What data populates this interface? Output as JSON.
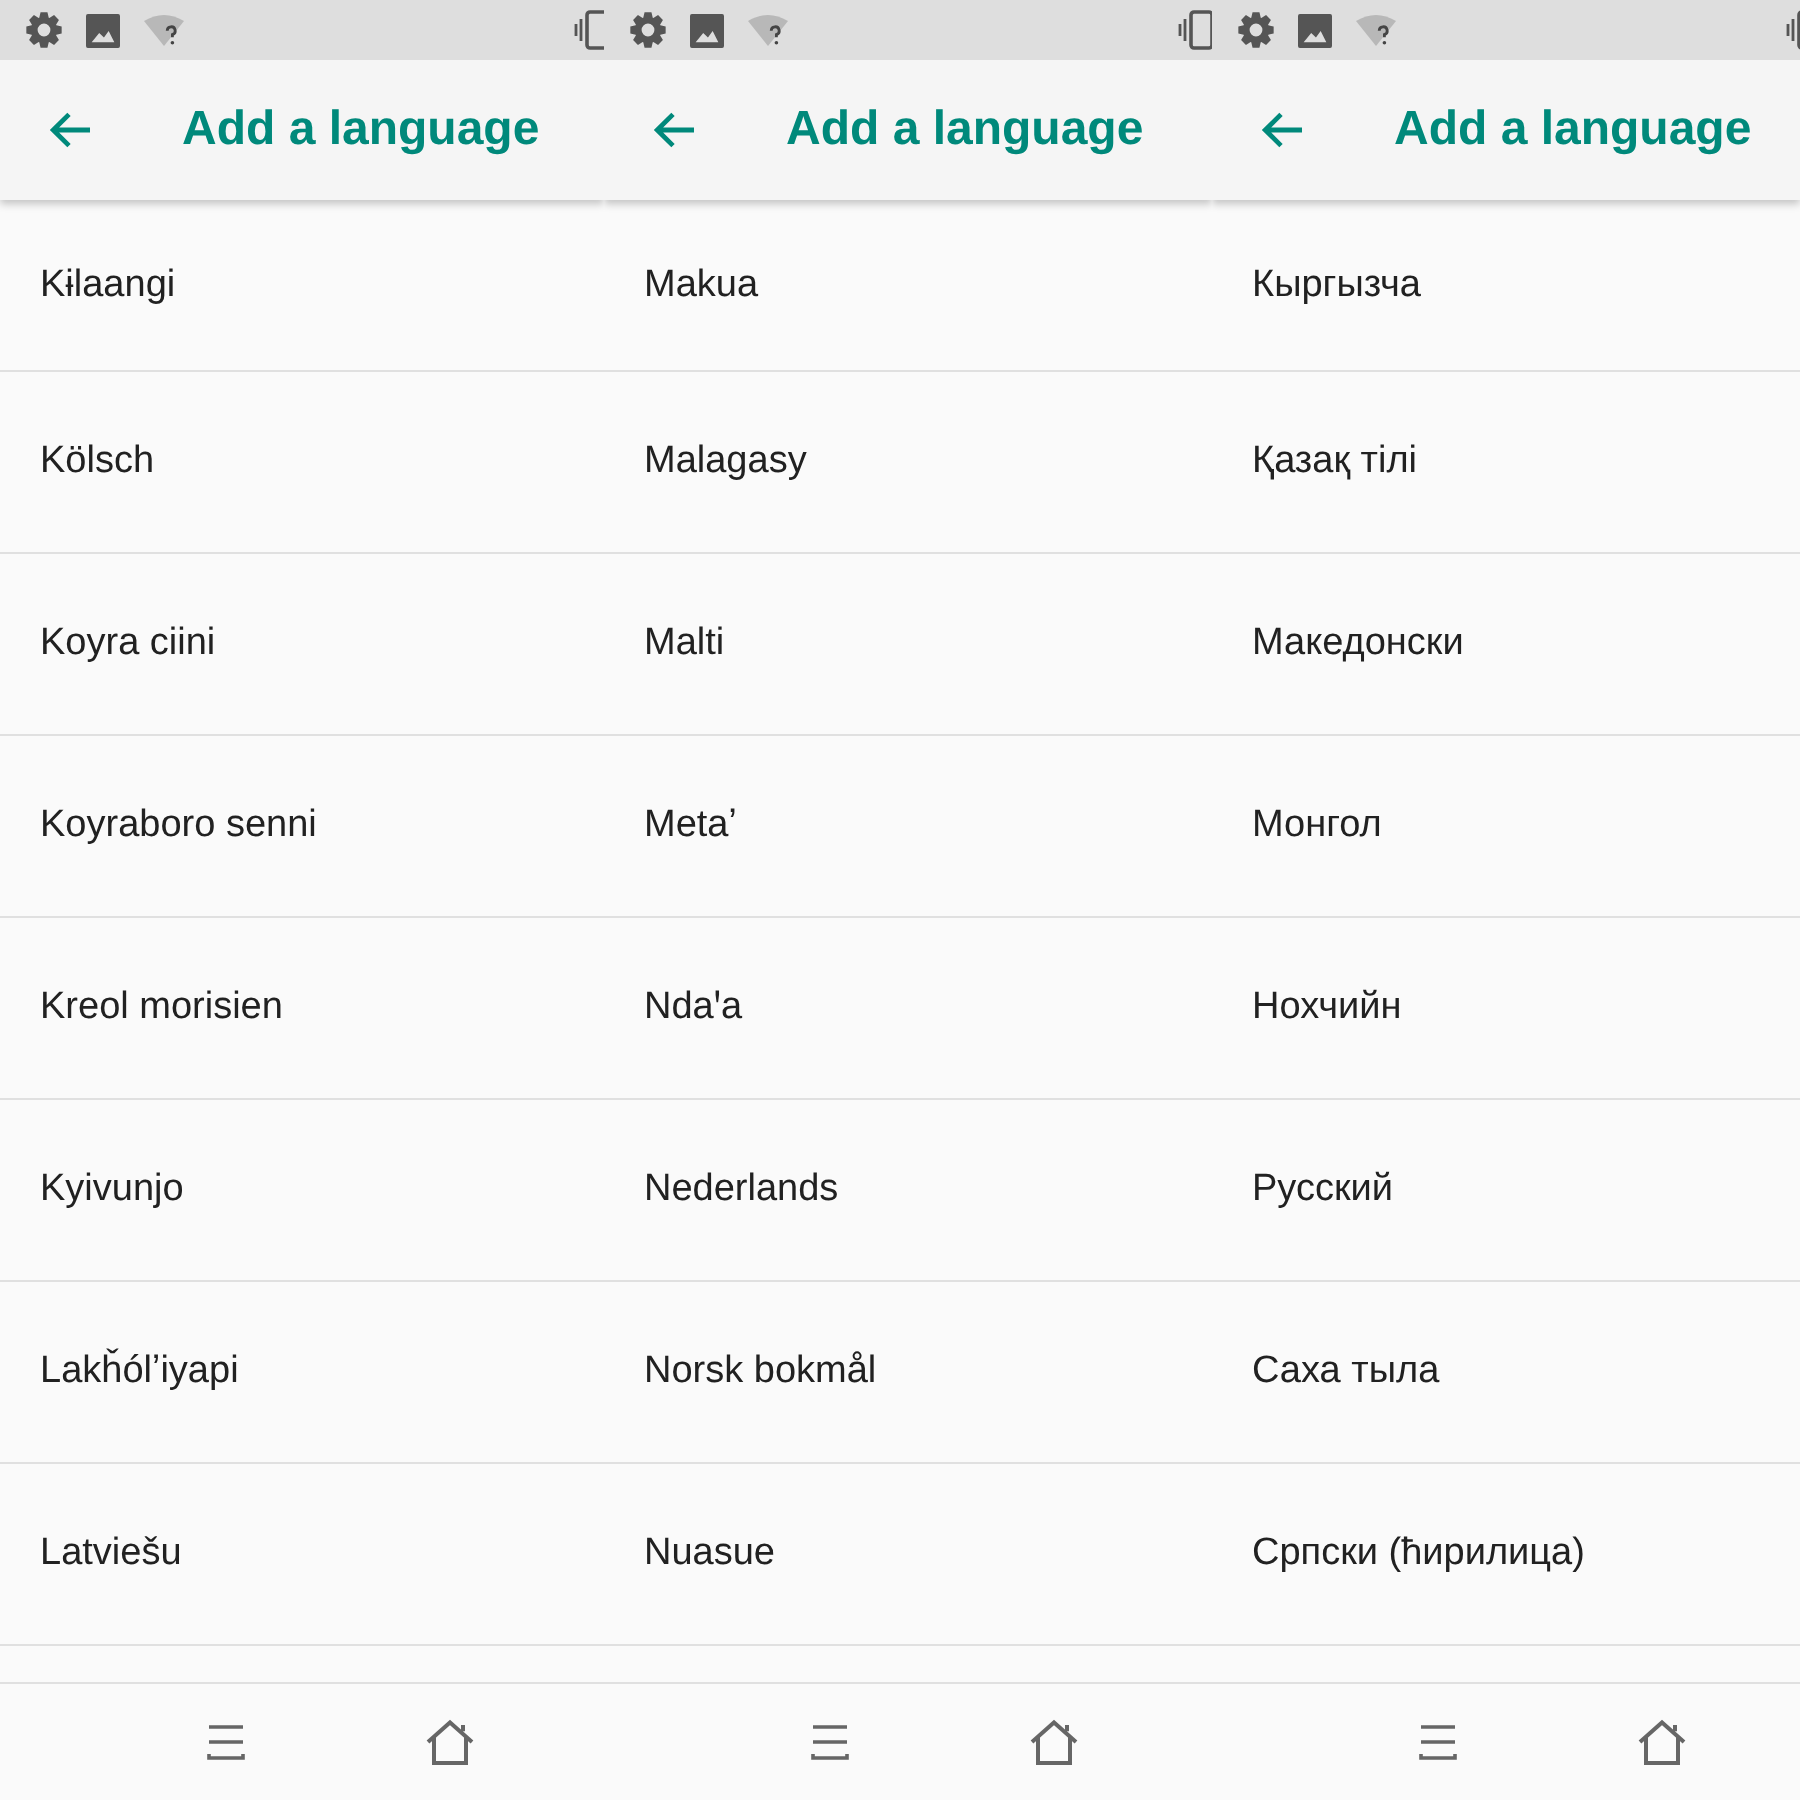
{
  "screens": [
    {
      "header": {
        "title": "Add a language"
      },
      "languages": [
        "Kɨlaangi",
        "Kölsch",
        "Koyra ciini",
        "Koyraboro senni",
        "Kreol morisien",
        "Kyivunjo",
        "Lakȟólʼiyapi",
        "Latviešu"
      ]
    },
    {
      "header": {
        "title": "Add a language"
      },
      "languages": [
        "Makua",
        "Malagasy",
        "Malti",
        "Metaʼ",
        "Ndaꞌa",
        "Nederlands",
        "Norsk bokmål",
        "Nuasue"
      ]
    },
    {
      "header": {
        "title": "Add a language"
      },
      "languages": [
        "Кыргызча",
        "Қазақ тілі",
        "Македонски",
        "Монгол",
        "Нохчийн",
        "Русский",
        "Саха тыла",
        "Српски (ћирилица)"
      ]
    }
  ]
}
